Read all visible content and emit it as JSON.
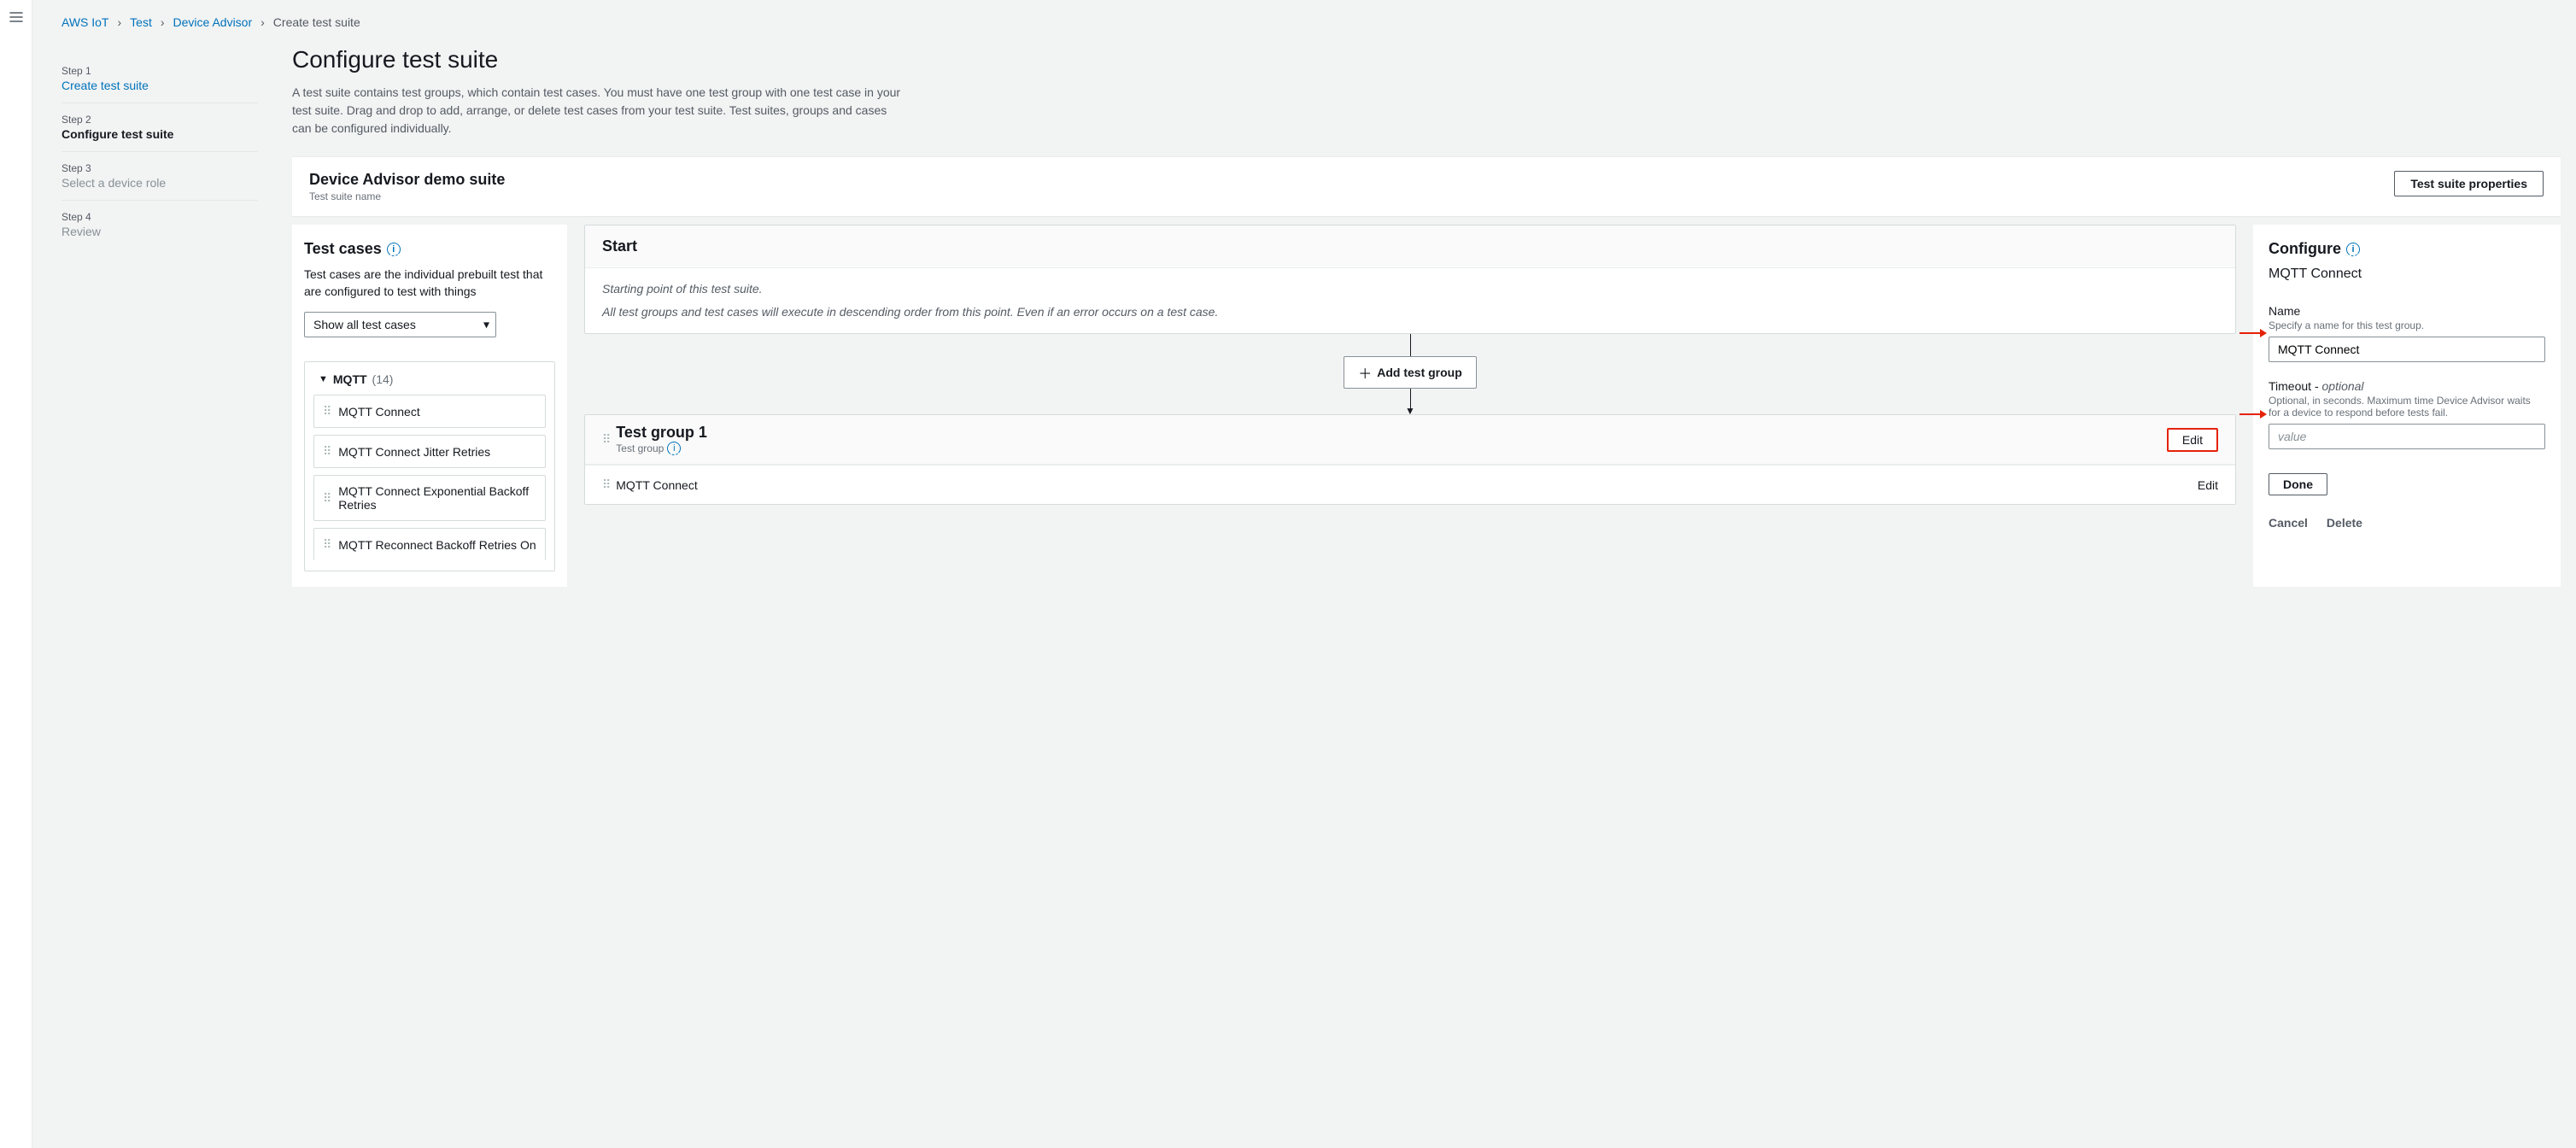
{
  "breadcrumb": {
    "items": [
      "AWS IoT",
      "Test",
      "Device Advisor"
    ],
    "current": "Create test suite"
  },
  "steps": [
    {
      "num": "Step 1",
      "title": "Create test suite",
      "state": "link"
    },
    {
      "num": "Step 2",
      "title": "Configure test suite",
      "state": "active"
    },
    {
      "num": "Step 3",
      "title": "Select a device role",
      "state": "disabled"
    },
    {
      "num": "Step 4",
      "title": "Review",
      "state": "disabled"
    }
  ],
  "page": {
    "title": "Configure test suite",
    "description": "A test suite contains test groups, which contain test cases. You must have one test group with one test case in your test suite. Drag and drop to add, arrange, or delete test cases from your test suite. Test suites, groups and cases can be configured individually."
  },
  "suite": {
    "name": "Device Advisor demo suite",
    "sub": "Test suite name",
    "properties_btn": "Test suite properties"
  },
  "testcases_panel": {
    "heading": "Test cases",
    "desc": "Test cases are the individual prebuilt test that are configured to test with things",
    "filter_label": "Show all test cases",
    "group": {
      "name": "MQTT",
      "count": "(14)"
    },
    "items": [
      "MQTT Connect",
      "MQTT Connect Jitter Retries",
      "MQTT Connect Exponential Backoff Retries",
      "MQTT Reconnect Backoff Retries On"
    ]
  },
  "flow": {
    "start_heading": "Start",
    "start_line1": "Starting point of this test suite.",
    "start_line2": "All test groups and test cases will execute in descending order from this point. Even if an error occurs on a test case.",
    "add_group_btn": "Add test group",
    "group": {
      "title": "Test group 1",
      "sub": "Test group",
      "edit": "Edit",
      "rows": [
        {
          "name": "MQTT Connect",
          "edit": "Edit"
        }
      ]
    }
  },
  "configure": {
    "heading": "Configure",
    "subject": "MQTT Connect",
    "name_field": {
      "label": "Name",
      "hint": "Specify a name for this test group.",
      "value": "MQTT Connect"
    },
    "timeout_field": {
      "label": "Timeout - ",
      "optional": "optional",
      "hint": "Optional, in seconds. Maximum time Device Advisor waits for a device to respond before tests fail.",
      "placeholder": "value"
    },
    "done": "Done",
    "cancel": "Cancel",
    "delete": "Delete"
  }
}
